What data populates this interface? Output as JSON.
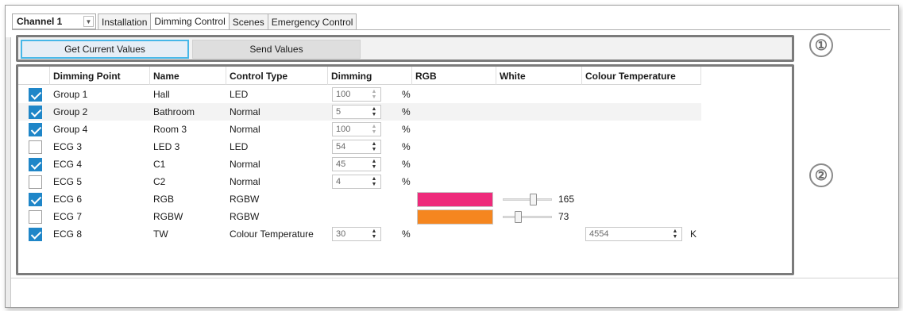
{
  "channel_select": {
    "value": "Channel 1"
  },
  "tabs": [
    {
      "label": "Installation",
      "active": false
    },
    {
      "label": "Dimming Control",
      "active": true
    },
    {
      "label": "Scenes",
      "active": false
    },
    {
      "label": "Emergency Control",
      "active": false
    }
  ],
  "toolbar": {
    "get_label": "Get Current Values",
    "send_label": "Send Values"
  },
  "markers": {
    "one": "①",
    "two": "②"
  },
  "columns": [
    "Dimming Point",
    "Name",
    "Control Type",
    "Dimming",
    "RGB",
    "White",
    "Colour Temperature"
  ],
  "rows": [
    {
      "checked": true,
      "point": "Group 1",
      "name": "Hall",
      "type": "LED",
      "dimming": "100",
      "dim_enabled": false,
      "unit": "%"
    },
    {
      "checked": true,
      "point": "Group 2",
      "name": "Bathroom",
      "type": "Normal",
      "dimming": "5",
      "dim_enabled": true,
      "unit": "%"
    },
    {
      "checked": true,
      "point": "Group 4",
      "name": "Room 3",
      "type": "Normal",
      "dimming": "100",
      "dim_enabled": false,
      "unit": "%"
    },
    {
      "checked": false,
      "point": "ECG 3",
      "name": "LED 3",
      "type": "LED",
      "dimming": "54",
      "dim_enabled": true,
      "unit": "%"
    },
    {
      "checked": true,
      "point": "ECG 4",
      "name": "C1",
      "type": "Normal",
      "dimming": "45",
      "dim_enabled": true,
      "unit": "%"
    },
    {
      "checked": false,
      "point": "ECG 5",
      "name": "C2",
      "type": "Normal",
      "dimming": "4",
      "dim_enabled": true,
      "unit": "%"
    },
    {
      "checked": true,
      "point": "ECG 6",
      "name": "RGB",
      "type": "RGBW",
      "rgb_color": "#ee2a7b",
      "white_level": 165,
      "white_value": "165",
      "white_fraction": 0.65
    },
    {
      "checked": false,
      "point": "ECG 7",
      "name": "RGBW",
      "type": "RGBW",
      "rgb_color": "#f5861f",
      "white_level": 73,
      "white_value": "73",
      "white_fraction": 0.29
    },
    {
      "checked": true,
      "point": "ECG 8",
      "name": "TW",
      "type": "Colour Temperature",
      "dimming": "30",
      "dim_enabled": true,
      "unit": "%",
      "temperature": "4554",
      "temp_unit": "K"
    }
  ],
  "colors": {
    "accent": "#1f86c8",
    "button_focus": "#47b7e8",
    "section_border": "#7b7b7b"
  }
}
